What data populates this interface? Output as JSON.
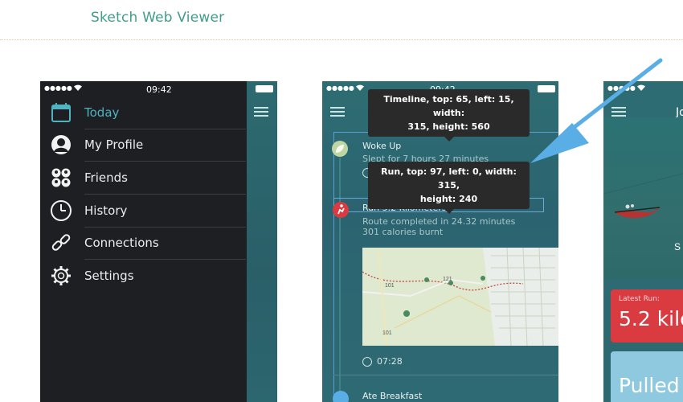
{
  "app": {
    "title": "Sketch Web Viewer"
  },
  "colors": {
    "accent": "#3f9e8a",
    "drawer_bg": "#1d1f22",
    "teal": "#2e6d73",
    "red": "#d93b41",
    "arrow": "#5aaee6"
  },
  "phone1": {
    "status": {
      "time": "09:42",
      "signal": "●●●●●"
    },
    "menu": [
      {
        "label": "Today",
        "icon": "calendar-icon",
        "active": true
      },
      {
        "label": "My Profile",
        "icon": "profile-icon",
        "active": false
      },
      {
        "label": "Friends",
        "icon": "friends-icon",
        "active": false
      },
      {
        "label": "History",
        "icon": "clock-icon",
        "active": false
      },
      {
        "label": "Connections",
        "icon": "link-icon",
        "active": false
      },
      {
        "label": "Settings",
        "icon": "gear-icon",
        "active": false
      }
    ]
  },
  "phone2": {
    "status": {
      "time": "09:42",
      "signal": "●●●●●"
    },
    "timeline": [
      {
        "title": "Woke Up",
        "sub": "Slept for 7 hours 27 minutes",
        "icon": "leaf-icon"
      },
      {
        "title": "Ran 5.2 Kilometers",
        "sub1": "Route completed in 24.32 minutes",
        "sub2": "301 calories burnt",
        "icon": "run-icon",
        "time": "07:28"
      },
      {
        "title": "Ate Breakfast",
        "icon": "food-icon"
      }
    ],
    "map": {
      "road_labels": [
        "101",
        "101",
        "121"
      ]
    },
    "tooltips": {
      "timeline": {
        "line1": "Timeline, top: 65, left: 15, width:",
        "line2": "315, height: 560"
      },
      "run": {
        "line1": "Run, top: 97, left: 0, width: 315,",
        "line2": "height: 240"
      }
    }
  },
  "phone3": {
    "status": {
      "signal": "●●●●●"
    },
    "header_partial": "Jo",
    "photo_caption_partial": "S",
    "latest_run_label": "Latest Run:",
    "latest_run_value": "5.2 kilo",
    "pulled_value": "Pulled"
  }
}
